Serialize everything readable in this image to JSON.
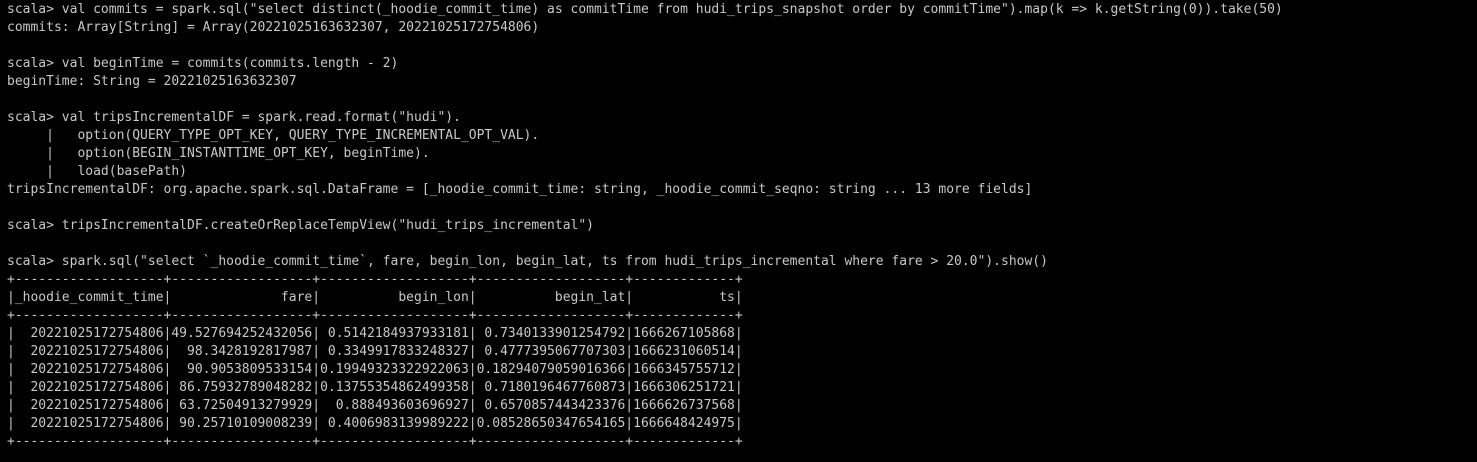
{
  "terminal": {
    "lines": [
      "scala> val commits = spark.sql(\"select distinct(_hoodie_commit_time) as commitTime from hudi_trips_snapshot order by commitTime\").map(k => k.getString(0)).take(50)",
      "commits: Array[String] = Array(20221025163632307, 20221025172754806)",
      "",
      "scala> val beginTime = commits(commits.length - 2)",
      "beginTime: String = 20221025163632307",
      "",
      "scala> val tripsIncrementalDF = spark.read.format(\"hudi\").",
      "     |   option(QUERY_TYPE_OPT_KEY, QUERY_TYPE_INCREMENTAL_OPT_VAL).",
      "     |   option(BEGIN_INSTANTTIME_OPT_KEY, beginTime).",
      "     |   load(basePath)",
      "tripsIncrementalDF: org.apache.spark.sql.DataFrame = [_hoodie_commit_time: string, _hoodie_commit_seqno: string ... 13 more fields]",
      "",
      "scala> tripsIncrementalDF.createOrReplaceTempView(\"hudi_trips_incremental\")",
      "",
      "scala> spark.sql(\"select `_hoodie_commit_time`, fare, begin_lon, begin_lat, ts from hudi_trips_incremental where fare > 20.0\").show()",
      "+-------------------+------------------+-------------------+-------------------+-------------+",
      "|_hoodie_commit_time|              fare|          begin_lon|          begin_lat|           ts|",
      "+-------------------+------------------+-------------------+-------------------+-------------+",
      "|  20221025172754806|49.527694252432056| 0.5142184937933181| 0.7340133901254792|1666267105868|",
      "|  20221025172754806|  98.3428192817987| 0.3349917833248327| 0.4777395067707303|1666231060514|",
      "|  20221025172754806|  90.9053809533154|0.19949323322922063|0.18294079059016366|1666345755712|",
      "|  20221025172754806| 86.75932789048282|0.13755354862499358| 0.7180196467760873|1666306251721|",
      "|  20221025172754806| 63.72504913279929|  0.888493603696927| 0.6570857443423376|1666626737568|",
      "|  20221025172754806| 90.25710109008239| 0.4006983139989222|0.08528650347654165|1666648424975|",
      "+-------------------+------------------+-------------------+-------------------+-------------+"
    ]
  }
}
